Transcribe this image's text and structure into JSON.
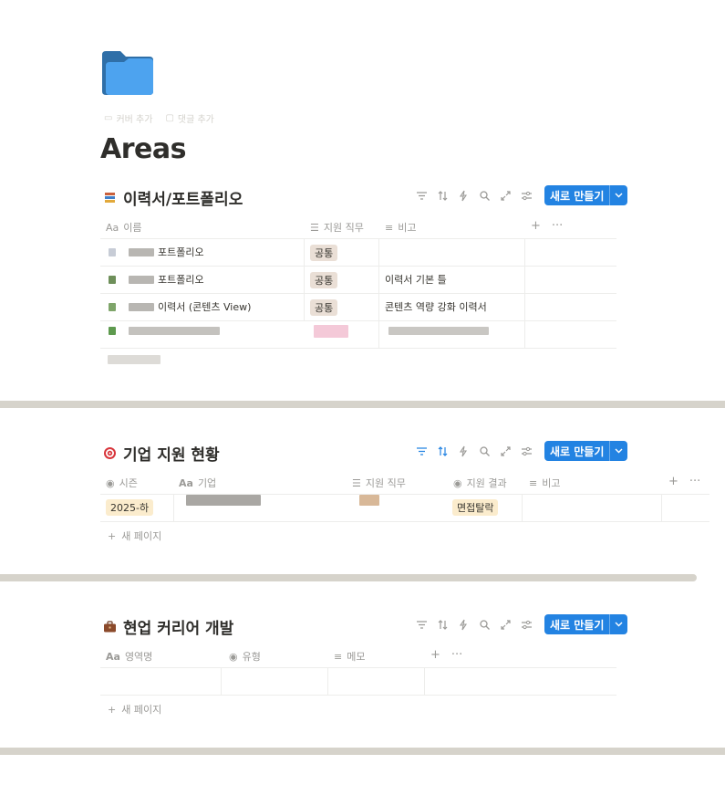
{
  "page": {
    "title": "Areas",
    "actions": {
      "add_cover": "커버 추가",
      "add_comment": "댓글 추가"
    }
  },
  "sections": {
    "portfolio": {
      "title": "이력서/포트폴리오",
      "new_button": "새로 만들기",
      "columns": {
        "name": "이름",
        "job": "지원 직무",
        "note": "비고"
      },
      "rows": [
        {
          "name": "포트폴리오",
          "job": "공통",
          "note": ""
        },
        {
          "name": "포트폴리오",
          "job": "공통",
          "note": "이력서 기본 틀"
        },
        {
          "name": "이력서 (콘텐츠 View)",
          "job": "공통",
          "note": "콘텐츠 역량 강화 이력서"
        }
      ],
      "new_page": "새 페이지"
    },
    "applications": {
      "title": "기업 지원 현황",
      "new_button": "새로 만들기",
      "columns": {
        "season": "시즌",
        "company": "기업",
        "job": "지원 직무",
        "result": "지원 결과",
        "note": "비고"
      },
      "rows": [
        {
          "season": "2025-하",
          "result": "면접탈락"
        }
      ],
      "new_page": "새 페이지"
    },
    "career": {
      "title": "현업 커리어 개발",
      "new_button": "새로 만들기",
      "columns": {
        "area": "영역명",
        "type": "유형",
        "memo": "메모"
      },
      "new_page": "새 페이지"
    }
  },
  "colors": {
    "accent": "#2383e2",
    "tag_common": "#eadfd6",
    "tag_season": "#fbeccd",
    "tag_result": "#fbeccd",
    "divider": "#d6d3cb"
  },
  "icons": {
    "page": "folder-icon",
    "portfolio": "books-icon",
    "applications": "target-icon",
    "career": "briefcase-icon"
  }
}
